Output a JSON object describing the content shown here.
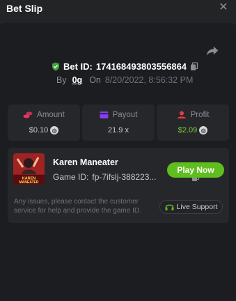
{
  "header": {
    "title": "Bet Slip",
    "close_icon": "close-icon"
  },
  "bet": {
    "id_label": "Bet ID:",
    "id_value": "174168493803556864",
    "by_label": "By",
    "user": "0g",
    "on_label": "On",
    "date": "8/20/2022, 8:56:32 PM"
  },
  "stats": {
    "amount": {
      "label": "Amount",
      "value": "$0.10",
      "icon": "coins-icon"
    },
    "payout": {
      "label": "Payout",
      "value": "21.9 x",
      "icon": "wallet-icon"
    },
    "profit": {
      "label": "Profit",
      "value": "$2.09",
      "icon": "profit-icon"
    }
  },
  "game": {
    "name": "Karen Maneater",
    "id_label": "Game ID:",
    "id_value": "fp-7ifslj-388223...",
    "thumb_text": "KAREN MANEATER",
    "play_label": "Play Now"
  },
  "notice": "Any issues, please contact the customer service for help and provide the game ID.",
  "support_label": "Live Support",
  "colors": {
    "accent_green": "#5fbe1e",
    "profit_green": "#7bd42f",
    "amount_pink": "#e8385f",
    "payout_purple": "#8a3ff0",
    "profit_red": "#e53d43"
  }
}
